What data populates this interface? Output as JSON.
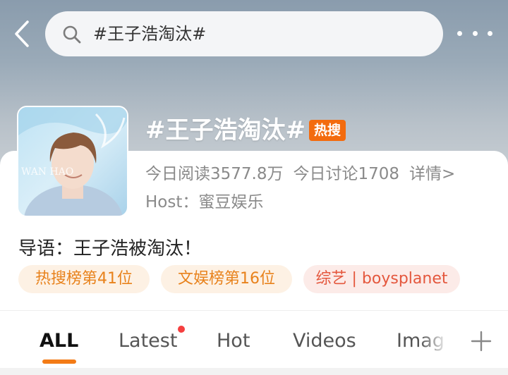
{
  "search": {
    "query": "#王子浩淘汰#"
  },
  "topic": {
    "title": "#王子浩淘汰#",
    "badge": "热搜",
    "reads": "今日阅读3577.8万",
    "discussions": "今日讨论1708",
    "details_link": "详情>",
    "host": "Host：蜜豆娱乐",
    "intro": "导语：王子浩被淘汰！",
    "avatar_text": "WAN HAO"
  },
  "tags": [
    "热搜榜第41位",
    "文娱榜第16位",
    "综艺 | boysplanet"
  ],
  "tabs": {
    "all": "ALL",
    "latest": "Latest",
    "hot": "Hot",
    "videos": "Videos",
    "images": "Imag"
  },
  "colors": {
    "accent": "#f37b16",
    "hot_badge": "#f36b0e",
    "notification_dot": "#f53f3f"
  },
  "icons": {
    "back": "chevron-left-icon",
    "search": "search-icon",
    "more": "more-dots-icon",
    "add": "plus-icon"
  }
}
